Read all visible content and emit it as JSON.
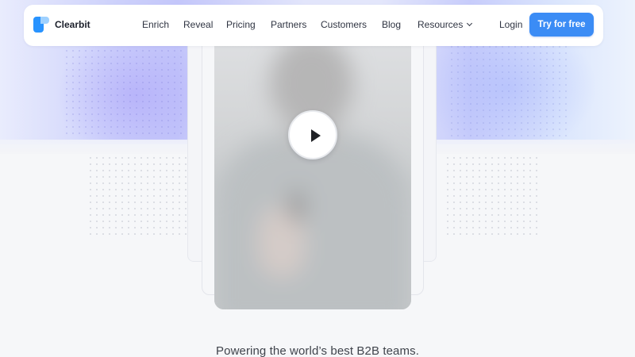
{
  "brand": {
    "name": "Clearbit",
    "logo_icon": "clearbit-logo-icon",
    "color": "#2893ff"
  },
  "nav": {
    "items": [
      {
        "label": "Enrich"
      },
      {
        "label": "Reveal"
      },
      {
        "label": "Pricing"
      },
      {
        "label": "Partners"
      },
      {
        "label": "Customers"
      },
      {
        "label": "Blog"
      },
      {
        "label": "Resources",
        "icon": "chevron-down-icon"
      }
    ],
    "login_label": "Login",
    "cta_label": "Try for free",
    "cta_color": "#3b8cf5"
  },
  "video": {
    "play_icon": "play-icon"
  },
  "hero": {
    "tagline": "Powering the world’s best B2B teams."
  }
}
